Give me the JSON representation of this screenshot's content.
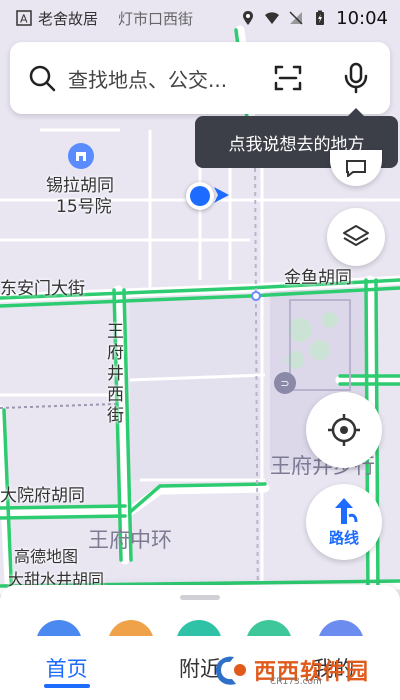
{
  "status_bar": {
    "left_text": "老舍故居",
    "left_text_2": "灯市口西街",
    "time": "10:04"
  },
  "search": {
    "placeholder": "查找地点、公交..."
  },
  "voice_tooltip": "点我说想去的地方",
  "map": {
    "poi_name": "锡拉胡同\n15号院",
    "poi_line1": "锡拉胡同",
    "poi_line2": "15号院",
    "streets": {
      "dongan": "东安门大街",
      "jinyu": "金鱼胡同",
      "wangfujing": "王府井西街",
      "dayuanfu": "大院府胡同",
      "wangfu_zhonghuan": "王府中环",
      "wangfujing_buxing": "王府井步行",
      "dagan": "大甜水井胡同"
    },
    "attribution": "高德地图",
    "map_marker_text": "期"
  },
  "controls": {
    "route_label": "路线"
  },
  "tabs": [
    {
      "label": "首页",
      "active": true
    },
    {
      "label": "附近",
      "active": false
    },
    {
      "label": "我的",
      "active": false
    }
  ],
  "watermark": {
    "title": "西西软件园",
    "sub": "CR173.com"
  },
  "colors": {
    "accent": "#1e6cff",
    "road": "#2ecc71",
    "tooltip_bg": "#3c3f48"
  }
}
